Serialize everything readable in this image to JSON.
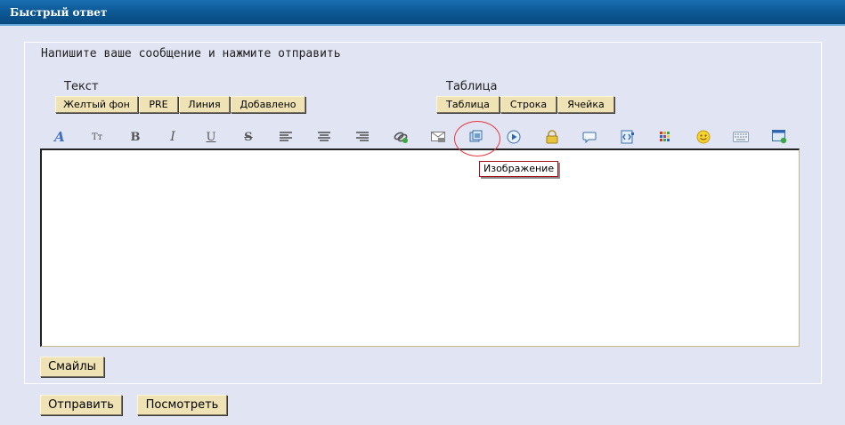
{
  "header": {
    "title": "Быстрый ответ"
  },
  "instruction": "Напишите ваше сообщение и нажмите отправить",
  "text_group": {
    "label": "Текст",
    "buttons": [
      "Желтый фон",
      "PRE",
      "Линия",
      "Добавлено"
    ]
  },
  "table_group": {
    "label": "Таблица",
    "buttons": [
      "Таблица",
      "Строка",
      "Ячейка"
    ]
  },
  "toolbar": {
    "bold_glyph": "B",
    "italic_glyph": "I",
    "underline_glyph": "U",
    "strike_glyph": "S",
    "fontsize_glyph": "Тт",
    "font_glyph": "A"
  },
  "tooltip": "Изображение",
  "editor": {
    "value": ""
  },
  "smileys_button": "Смайлы",
  "submit_button": "Отправить",
  "preview_button": "Посмотреть",
  "colors": {
    "header_bg": "#0d5a97",
    "page_bg": "#e1e4f2",
    "button_bg": "#efe3b5",
    "tooltip_border": "#a3121b",
    "highlight": "#e8383d"
  }
}
